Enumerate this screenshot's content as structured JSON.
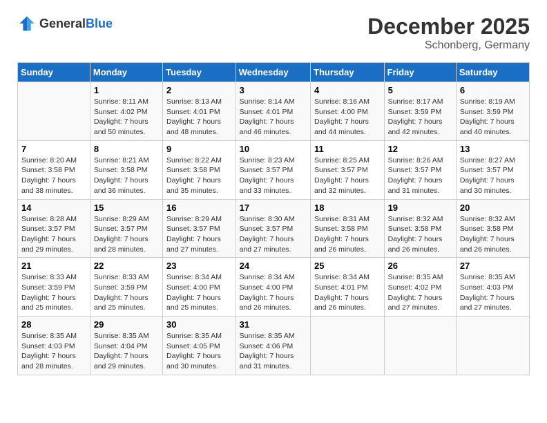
{
  "logo": {
    "general": "General",
    "blue": "Blue"
  },
  "title": {
    "month": "December 2025",
    "location": "Schonberg, Germany"
  },
  "days_of_week": [
    "Sunday",
    "Monday",
    "Tuesday",
    "Wednesday",
    "Thursday",
    "Friday",
    "Saturday"
  ],
  "weeks": [
    [
      {
        "day": "",
        "info": ""
      },
      {
        "day": "1",
        "info": "Sunrise: 8:11 AM\nSunset: 4:02 PM\nDaylight: 7 hours\nand 50 minutes."
      },
      {
        "day": "2",
        "info": "Sunrise: 8:13 AM\nSunset: 4:01 PM\nDaylight: 7 hours\nand 48 minutes."
      },
      {
        "day": "3",
        "info": "Sunrise: 8:14 AM\nSunset: 4:01 PM\nDaylight: 7 hours\nand 46 minutes."
      },
      {
        "day": "4",
        "info": "Sunrise: 8:16 AM\nSunset: 4:00 PM\nDaylight: 7 hours\nand 44 minutes."
      },
      {
        "day": "5",
        "info": "Sunrise: 8:17 AM\nSunset: 3:59 PM\nDaylight: 7 hours\nand 42 minutes."
      },
      {
        "day": "6",
        "info": "Sunrise: 8:19 AM\nSunset: 3:59 PM\nDaylight: 7 hours\nand 40 minutes."
      }
    ],
    [
      {
        "day": "7",
        "info": "Sunrise: 8:20 AM\nSunset: 3:58 PM\nDaylight: 7 hours\nand 38 minutes."
      },
      {
        "day": "8",
        "info": "Sunrise: 8:21 AM\nSunset: 3:58 PM\nDaylight: 7 hours\nand 36 minutes."
      },
      {
        "day": "9",
        "info": "Sunrise: 8:22 AM\nSunset: 3:58 PM\nDaylight: 7 hours\nand 35 minutes."
      },
      {
        "day": "10",
        "info": "Sunrise: 8:23 AM\nSunset: 3:57 PM\nDaylight: 7 hours\nand 33 minutes."
      },
      {
        "day": "11",
        "info": "Sunrise: 8:25 AM\nSunset: 3:57 PM\nDaylight: 7 hours\nand 32 minutes."
      },
      {
        "day": "12",
        "info": "Sunrise: 8:26 AM\nSunset: 3:57 PM\nDaylight: 7 hours\nand 31 minutes."
      },
      {
        "day": "13",
        "info": "Sunrise: 8:27 AM\nSunset: 3:57 PM\nDaylight: 7 hours\nand 30 minutes."
      }
    ],
    [
      {
        "day": "14",
        "info": "Sunrise: 8:28 AM\nSunset: 3:57 PM\nDaylight: 7 hours\nand 29 minutes."
      },
      {
        "day": "15",
        "info": "Sunrise: 8:29 AM\nSunset: 3:57 PM\nDaylight: 7 hours\nand 28 minutes."
      },
      {
        "day": "16",
        "info": "Sunrise: 8:29 AM\nSunset: 3:57 PM\nDaylight: 7 hours\nand 27 minutes."
      },
      {
        "day": "17",
        "info": "Sunrise: 8:30 AM\nSunset: 3:57 PM\nDaylight: 7 hours\nand 27 minutes."
      },
      {
        "day": "18",
        "info": "Sunrise: 8:31 AM\nSunset: 3:58 PM\nDaylight: 7 hours\nand 26 minutes."
      },
      {
        "day": "19",
        "info": "Sunrise: 8:32 AM\nSunset: 3:58 PM\nDaylight: 7 hours\nand 26 minutes."
      },
      {
        "day": "20",
        "info": "Sunrise: 8:32 AM\nSunset: 3:58 PM\nDaylight: 7 hours\nand 26 minutes."
      }
    ],
    [
      {
        "day": "21",
        "info": "Sunrise: 8:33 AM\nSunset: 3:59 PM\nDaylight: 7 hours\nand 25 minutes."
      },
      {
        "day": "22",
        "info": "Sunrise: 8:33 AM\nSunset: 3:59 PM\nDaylight: 7 hours\nand 25 minutes."
      },
      {
        "day": "23",
        "info": "Sunrise: 8:34 AM\nSunset: 4:00 PM\nDaylight: 7 hours\nand 25 minutes."
      },
      {
        "day": "24",
        "info": "Sunrise: 8:34 AM\nSunset: 4:00 PM\nDaylight: 7 hours\nand 26 minutes."
      },
      {
        "day": "25",
        "info": "Sunrise: 8:34 AM\nSunset: 4:01 PM\nDaylight: 7 hours\nand 26 minutes."
      },
      {
        "day": "26",
        "info": "Sunrise: 8:35 AM\nSunset: 4:02 PM\nDaylight: 7 hours\nand 27 minutes."
      },
      {
        "day": "27",
        "info": "Sunrise: 8:35 AM\nSunset: 4:03 PM\nDaylight: 7 hours\nand 27 minutes."
      }
    ],
    [
      {
        "day": "28",
        "info": "Sunrise: 8:35 AM\nSunset: 4:03 PM\nDaylight: 7 hours\nand 28 minutes."
      },
      {
        "day": "29",
        "info": "Sunrise: 8:35 AM\nSunset: 4:04 PM\nDaylight: 7 hours\nand 29 minutes."
      },
      {
        "day": "30",
        "info": "Sunrise: 8:35 AM\nSunset: 4:05 PM\nDaylight: 7 hours\nand 30 minutes."
      },
      {
        "day": "31",
        "info": "Sunrise: 8:35 AM\nSunset: 4:06 PM\nDaylight: 7 hours\nand 31 minutes."
      },
      {
        "day": "",
        "info": ""
      },
      {
        "day": "",
        "info": ""
      },
      {
        "day": "",
        "info": ""
      }
    ]
  ]
}
